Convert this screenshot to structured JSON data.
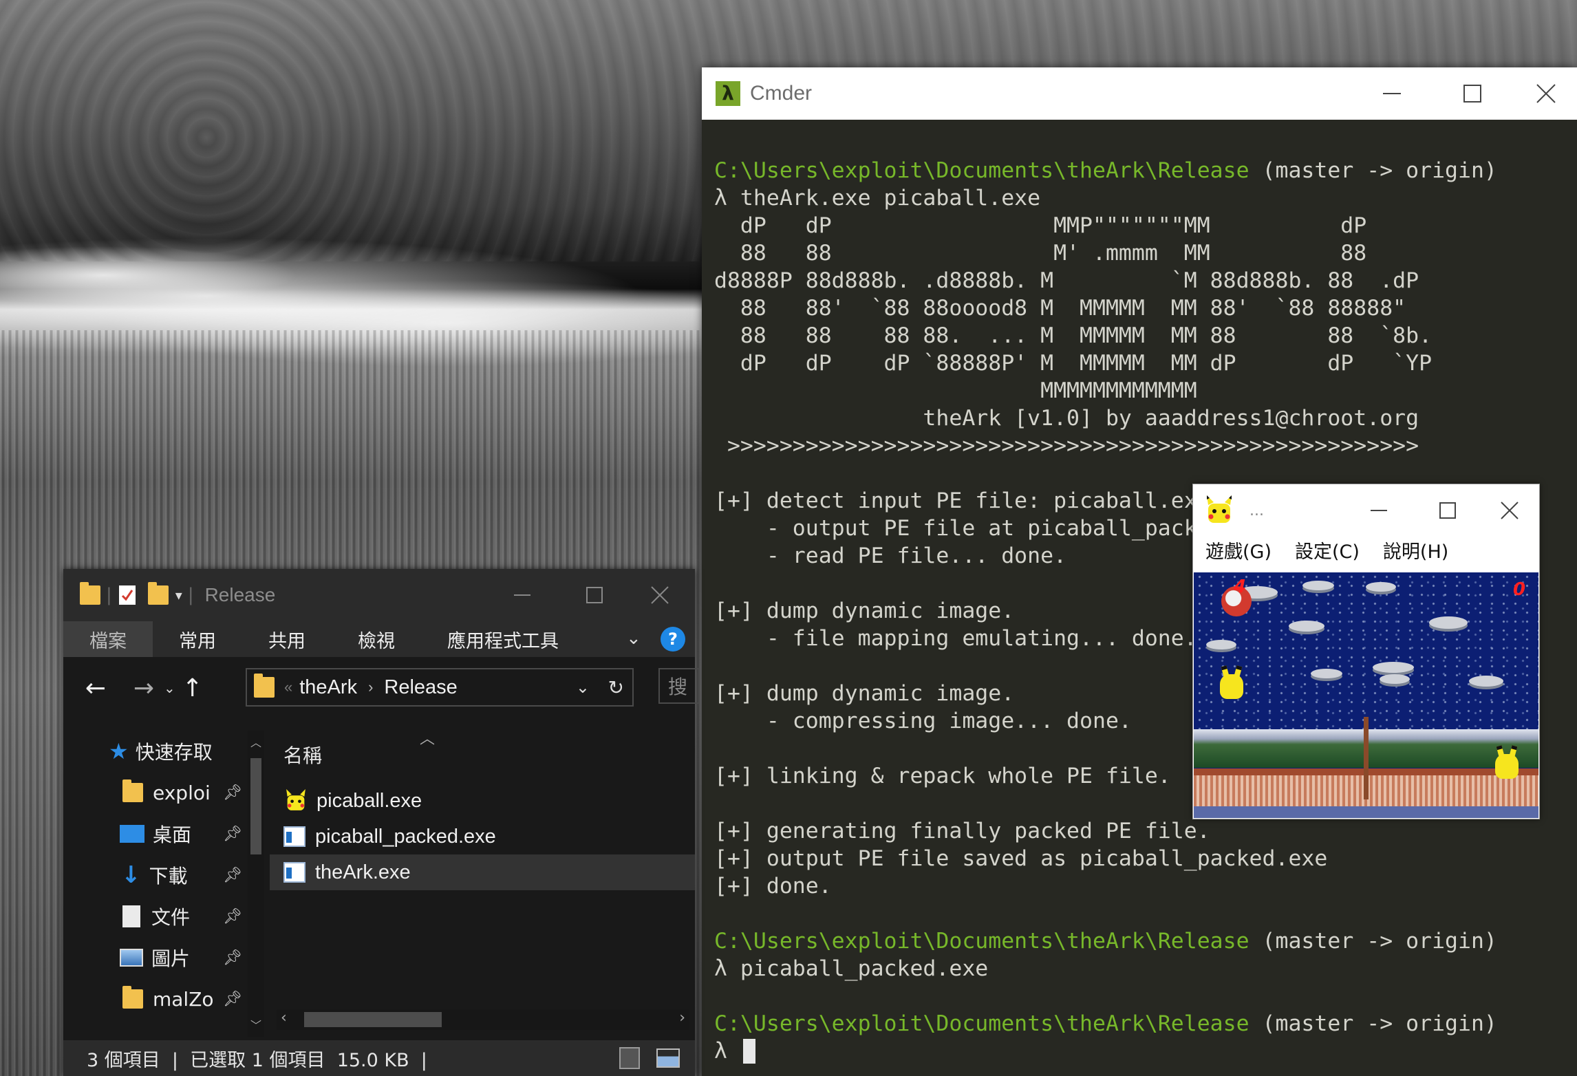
{
  "cmder": {
    "title": "Cmder",
    "lines": [
      {
        "path": "C:\\Users\\exploit\\Documents\\theArk\\Release",
        "branch": " (master -> origin)"
      },
      {
        "text": "λ theArk.exe picaball.exe"
      },
      {
        "text": "  dP   dP                 MMP\"\"\"\"\"\"\"MM          dP"
      },
      {
        "text": "  88   88                 M' .mmmm  MM          88"
      },
      {
        "text": "d8888P 88d888b. .d8888b. M         `M 88d888b. 88  .dP"
      },
      {
        "text": "  88   88'  `88 88ooood8 M  MMMMM  MM 88'  `88 88888\""
      },
      {
        "text": "  88   88    88 88.  ... M  MMMMM  MM 88       88  `8b."
      },
      {
        "text": "  dP   dP    dP `88888P' M  MMMMM  MM dP       dP   `YP"
      },
      {
        "text": "                         MMMMMMMMMMMM"
      },
      {
        "text": "                theArk [v1.0] by aaaddress1@chroot.org"
      },
      {
        "text": " >>>>>>>>>>>>>>>>>>>>>>>>>>>>>>>>>>>>>>>>>>>>>>>>>>>>>"
      },
      {
        "text": ""
      },
      {
        "text": "[+] detect input PE file: picaball.exe"
      },
      {
        "text": "    - output PE file at picaball_packed"
      },
      {
        "text": "    - read PE file... done."
      },
      {
        "text": ""
      },
      {
        "text": "[+] dump dynamic image."
      },
      {
        "text": "    - file mapping emulating... done."
      },
      {
        "text": ""
      },
      {
        "text": "[+] dump dynamic image."
      },
      {
        "text": "    - compressing image... done."
      },
      {
        "text": ""
      },
      {
        "text": "[+] linking & repack whole PE file."
      },
      {
        "text": ""
      },
      {
        "text": "[+] generating finally packed PE file."
      },
      {
        "text": "[+] output PE file saved as picaball_packed.exe"
      },
      {
        "text": "[+] done."
      },
      {
        "text": ""
      },
      {
        "path": "C:\\Users\\exploit\\Documents\\theArk\\Release",
        "branch": " (master -> origin)"
      },
      {
        "text": "λ picaball_packed.exe"
      },
      {
        "text": ""
      },
      {
        "path": "C:\\Users\\exploit\\Documents\\theArk\\Release",
        "branch": " (master -> origin)"
      }
    ],
    "prompt": "λ ",
    "colors": {
      "background": "#272822",
      "path": "#77b82a",
      "text": "#d4d4cc"
    }
  },
  "game": {
    "title": "...",
    "menu": [
      "遊戲(G)",
      "設定(C)",
      "說明(H)"
    ],
    "score_left": "4",
    "score_right": "0"
  },
  "explorer": {
    "title": "Release",
    "ribbon_tabs": [
      "檔案",
      "常用",
      "共用",
      "檢視",
      "應用程式工具"
    ],
    "breadcrumb_prefix": "«",
    "breadcrumb": [
      "theArk",
      "Release"
    ],
    "search_placeholder": "搜",
    "nav_items": [
      {
        "label": "快速存取",
        "icon": "star-icon"
      },
      {
        "label": "exploi",
        "icon": "folder-icon",
        "pinned": true
      },
      {
        "label": "桌面",
        "icon": "desktop-icon",
        "pinned": true
      },
      {
        "label": "下載",
        "icon": "download-icon",
        "pinned": true
      },
      {
        "label": "文件",
        "icon": "document-icon",
        "pinned": true
      },
      {
        "label": "圖片",
        "icon": "pictures-icon",
        "pinned": true
      },
      {
        "label": "malZo",
        "icon": "folder-icon",
        "pinned": true
      }
    ],
    "column_header": "名稱",
    "files": [
      {
        "name": "picaball.exe",
        "icon": "pikachu-icon"
      },
      {
        "name": "picaball_packed.exe",
        "icon": "exe-icon"
      },
      {
        "name": "theArk.exe",
        "icon": "exe-icon",
        "selected": true
      }
    ],
    "status": "3 個項目  |  已選取 1 個項目  15.0 KB  |"
  }
}
